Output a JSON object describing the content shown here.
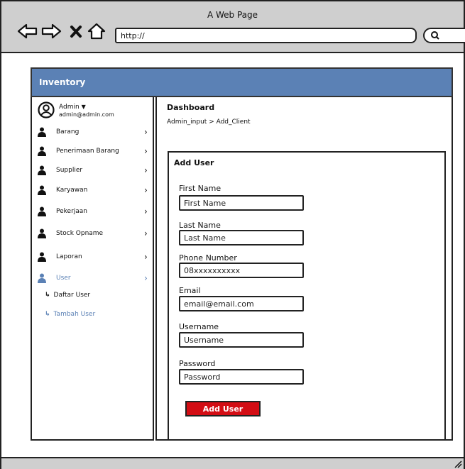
{
  "window": {
    "title": "A Web Page",
    "url": "http://"
  },
  "app": {
    "title": "Inventory",
    "accent_color": "#5b81b5",
    "danger_color": "#d30d14"
  },
  "profile": {
    "name": "Admin",
    "email": "admin@admin.com",
    "icon": "user-avatar-icon"
  },
  "sidebar": {
    "items": [
      {
        "label": "Barang",
        "icon": "person-icon"
      },
      {
        "label": "Penerimaan Barang",
        "icon": "person-icon"
      },
      {
        "label": "Supplier",
        "icon": "person-icon"
      },
      {
        "label": "Karyawan",
        "icon": "person-icon"
      },
      {
        "label": "Pekerjaan",
        "icon": "person-icon"
      },
      {
        "label": "Stock Opname",
        "icon": "person-icon"
      },
      {
        "label": "Laporan",
        "icon": "person-icon"
      },
      {
        "label": "User",
        "icon": "person-icon",
        "active": true
      }
    ],
    "sub_items": [
      {
        "label": "Daftar User"
      },
      {
        "label": "Tambah User",
        "active": true
      }
    ]
  },
  "main": {
    "title": "Dashboard",
    "breadcrumb": "Admin_input > Add_Client"
  },
  "form": {
    "title": "Add User",
    "fields": [
      {
        "label": "First Name",
        "placeholder": "First Name"
      },
      {
        "label": "Last Name",
        "placeholder": "Last Name"
      },
      {
        "label": "Phone Number",
        "placeholder": "08xxxxxxxxxx"
      },
      {
        "label": "Email",
        "placeholder": "email@email.com"
      },
      {
        "label": "Username",
        "placeholder": "Username"
      },
      {
        "label": "Password",
        "placeholder": "Password"
      }
    ],
    "submit_label": "Add User"
  }
}
